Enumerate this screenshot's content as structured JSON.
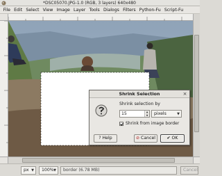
{
  "window": {
    "title": "*DSC05070.JPG-1.0 (RGB, 3 layers) 640x480"
  },
  "menu": {
    "items": [
      "File",
      "Edit",
      "Select",
      "View",
      "Image",
      "Layer",
      "Tools",
      "Dialogs",
      "Filters",
      "Python-Fu",
      "Script-Fu"
    ]
  },
  "statusbar": {
    "unit": "px",
    "zoom": "100%",
    "message": "border (6.78 MB)",
    "cancel": "Cancel"
  },
  "dialog": {
    "title": "Shrink Selection",
    "label": "Shrink selection by",
    "value": "15",
    "units": "pixels",
    "checkbox_label": "Shrink from image border",
    "checkbox_checked": true,
    "help": "Help",
    "cancel": "Cancel",
    "ok": "OK"
  },
  "icons": {
    "window": "gimp-wilber-icon",
    "dialog": "shrink-selection-icon",
    "close": "close-icon"
  }
}
